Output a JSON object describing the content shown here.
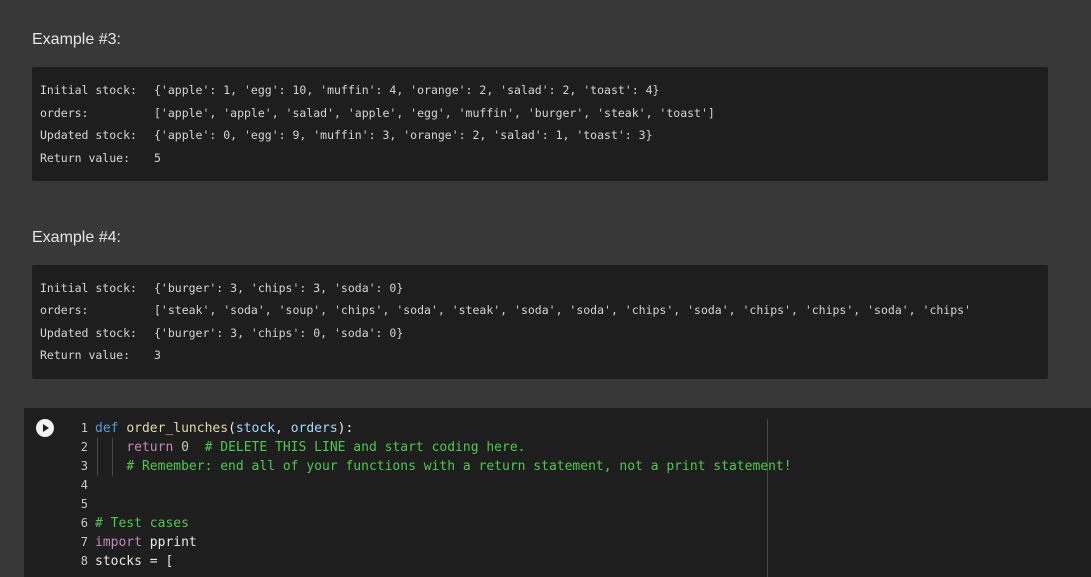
{
  "examples": [
    {
      "heading": "Example #3:",
      "lines": [
        {
          "label": "Initial stock:",
          "value": "{'apple': 1, 'egg': 10, 'muffin': 4, 'orange': 2, 'salad': 2, 'toast': 4}"
        },
        {
          "label": "orders:",
          "value": "['apple', 'apple', 'salad', 'apple', 'egg', 'muffin', 'burger', 'steak', 'toast']"
        },
        {
          "label": "Updated stock:",
          "value": "{'apple': 0, 'egg': 9, 'muffin': 3, 'orange': 2, 'salad': 1, 'toast': 3}"
        },
        {
          "label": "Return value:",
          "value": "5"
        }
      ]
    },
    {
      "heading": "Example #4:",
      "lines": [
        {
          "label": "Initial stock:",
          "value": "{'burger': 3, 'chips': 3, 'soda': 0}"
        },
        {
          "label": "orders:",
          "value": "['steak', 'soda', 'soup', 'chips', 'soda', 'steak', 'soda', 'soda', 'chips', 'soda', 'chips', 'chips', 'soda', 'chips'"
        },
        {
          "label": "Updated stock:",
          "value": "{'burger': 3, 'chips': 0, 'soda': 0}"
        },
        {
          "label": "Return value:",
          "value": "3"
        }
      ]
    }
  ],
  "code_cell": {
    "run_icon": "play-icon",
    "line_numbers": [
      "1",
      "2",
      "3",
      "4",
      "5",
      "6",
      "7",
      "8"
    ],
    "line1": {
      "def": "def",
      "name": "order_lunches",
      "open": "(",
      "p1": "stock",
      "sep": ", ",
      "p2": "orders",
      "close": "):"
    },
    "line2": {
      "kw": "return",
      "num": "0",
      "comment": "# DELETE THIS LINE and start coding here."
    },
    "line3": {
      "comment": "# Remember: end all of your functions with a return statement, not a print statement!"
    },
    "line6": {
      "comment": "# Test cases"
    },
    "line7": {
      "kw": "import",
      "rest": "pprint"
    },
    "line8": {
      "text": "stocks = ["
    }
  },
  "colors": {
    "background": "#383838",
    "panel": "#1e1e1e",
    "keyword": "#569cd6",
    "comment": "#4ec94e"
  }
}
